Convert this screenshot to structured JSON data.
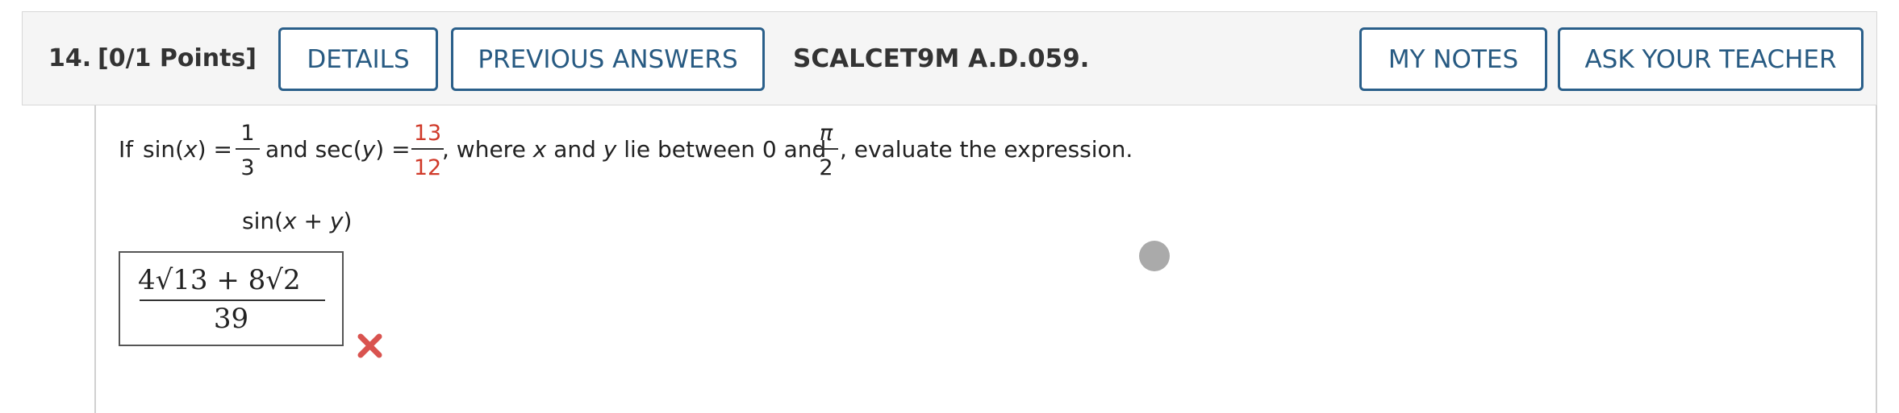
{
  "header": {
    "question_number": "14.",
    "points": "[0/1 Points]",
    "details_label": "DETAILS",
    "previous_answers_label": "PREVIOUS ANSWERS",
    "problem_code": "SCALCET9M A.D.059.",
    "my_notes_label": "MY NOTES",
    "ask_teacher_label": "ASK YOUR TEACHER"
  },
  "problem": {
    "if": "If",
    "sin_x": "sin(",
    "x": "x",
    "close_eq": ") =",
    "sin_num": "1",
    "sin_den": "3",
    "and_sec": "and sec(",
    "y": "y",
    "close_eq2": ") =",
    "sec_num": "13",
    "sec_den": "12",
    "where_text": ", where",
    "and_text": "and",
    "lie_text": "lie between 0 and",
    "pi": "π",
    "two": "2",
    "evaluate_text": ", evaluate the expression.",
    "expression": "sin(x + y)"
  },
  "answer": {
    "numerator": "4√13 + 8√2",
    "denominator": "39",
    "status": "incorrect"
  },
  "colors": {
    "accent": "#275a82",
    "incorrect": "#d03a2a"
  }
}
